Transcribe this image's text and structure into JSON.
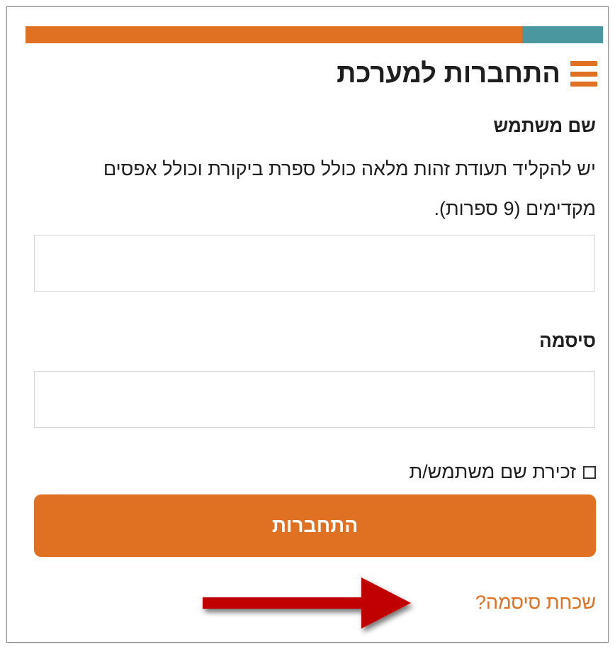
{
  "header": {
    "title": "התחברות למערכת",
    "menu_icon": "hamburger-menu-icon"
  },
  "form": {
    "username_label": "שם משתמש",
    "username_help": "יש להקליד תעודת זהות מלאה כולל ספרת ביקורת וכולל אפסים מקדימים (9 ספרות).",
    "username_value": "",
    "password_label": "סיסמה",
    "password_value": "",
    "remember_label": "זכירת שם משתמש/ת",
    "remember_checked": false,
    "login_button": "התחברות",
    "forgot_link": "שכחת סיסמה?"
  },
  "annotation": {
    "arrow_icon": "red-arrow-icon",
    "arrow_color": "#c00000"
  },
  "colors": {
    "accent_orange": "#e07122",
    "accent_teal": "#4b97a0"
  }
}
